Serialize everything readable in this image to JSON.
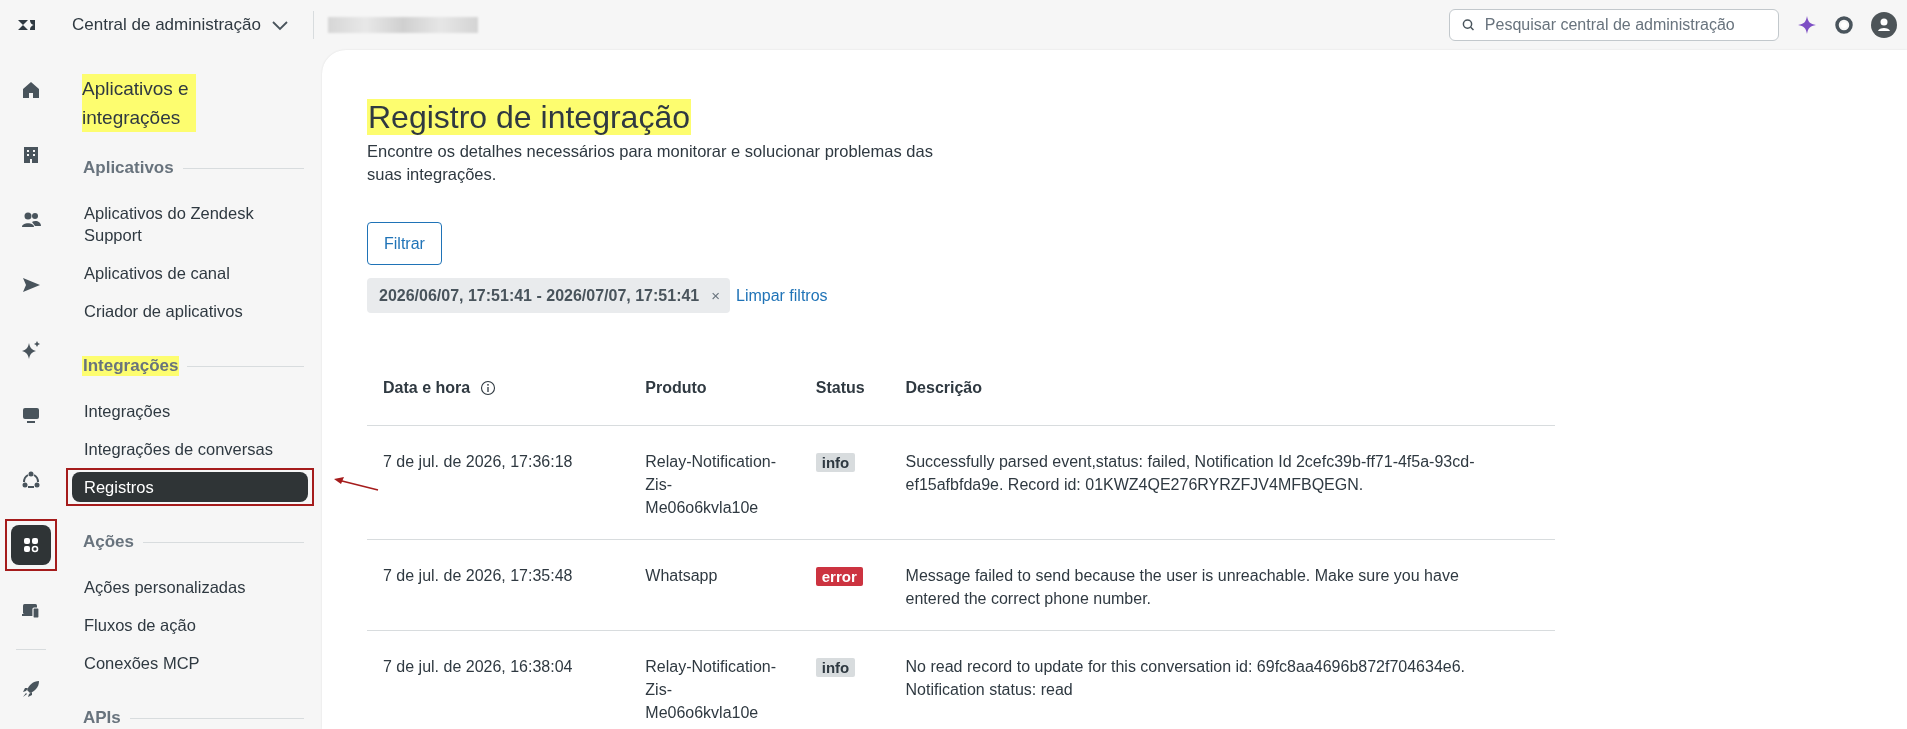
{
  "topbar": {
    "product": "Central de administração",
    "search": {
      "placeholder": "Pesquisar central de administração"
    }
  },
  "rail": {
    "items": [
      {
        "kind": "home",
        "selected": false,
        "annotated": false
      },
      {
        "kind": "building",
        "selected": false,
        "annotated": false
      },
      {
        "kind": "people",
        "selected": false,
        "annotated": false
      },
      {
        "kind": "send",
        "selected": false,
        "annotated": false
      },
      {
        "kind": "sparkle",
        "selected": false,
        "annotated": false
      },
      {
        "kind": "monitor",
        "selected": false,
        "annotated": false
      },
      {
        "kind": "cycle",
        "selected": false,
        "annotated": false
      },
      {
        "kind": "apps",
        "selected": true,
        "annotated": true
      },
      {
        "kind": "devices",
        "selected": false,
        "annotated": false
      }
    ],
    "footer": [
      {
        "kind": "rocket",
        "selected": false,
        "annotated": false
      }
    ]
  },
  "sidebar": {
    "heading": {
      "text": "Aplicativos e integrações",
      "highlighted": true
    },
    "sections": [
      {
        "title": "Aplicativos",
        "highlighted": false,
        "items": [
          {
            "label": "Aplicativos do Zendesk Support",
            "selected": false,
            "annotated": false
          },
          {
            "label": "Aplicativos de canal",
            "selected": false,
            "annotated": false
          },
          {
            "label": "Criador de aplicativos",
            "selected": false,
            "annotated": false
          }
        ]
      },
      {
        "title": "Integrações",
        "highlighted": true,
        "items": [
          {
            "label": "Integrações",
            "selected": false,
            "annotated": false
          },
          {
            "label": "Integrações de conversas",
            "selected": false,
            "annotated": false
          },
          {
            "label": "Registros",
            "selected": true,
            "annotated": true
          }
        ]
      },
      {
        "title": "Ações",
        "highlighted": false,
        "items": [
          {
            "label": "Ações personalizadas",
            "selected": false,
            "annotated": false
          },
          {
            "label": "Fluxos de ação",
            "selected": false,
            "annotated": false
          },
          {
            "label": "Conexões MCP",
            "selected": false,
            "annotated": false
          }
        ]
      },
      {
        "title": "APIs",
        "highlighted": false
      }
    ]
  },
  "page": {
    "title": "Registro de integração",
    "title_highlighted": true,
    "description": "Encontre os detalhes necessários para monitorar e solucionar problemas das suas integrações.",
    "filter_button": "Filtrar",
    "chip": {
      "label": "2026/06/07, 17:51:41 - 2026/07/07, 17:51:41",
      "remove": "×"
    },
    "clear_link": "Limpar filtros",
    "annotation_arrow": true
  },
  "table": {
    "columns": [
      {
        "label": "Data e hora",
        "info": true
      },
      {
        "label": "Produto",
        "info": false
      },
      {
        "label": "Status",
        "info": false
      },
      {
        "label": "Descrição",
        "info": false
      }
    ],
    "rows": [
      {
        "date": "7 de jul. de 2026, 17:36:18",
        "product": "Relay-Notification-Zis-Me06o6kvla10e",
        "status": {
          "text": "info",
          "kind": "info"
        },
        "description": "Successfully parsed event,status: failed, Notification Id 2cefc39b-ff71-4f5a-93cd-ef15afbfda9e. Record id: 01KWZ4QE276RYRZFJV4MFBQEGN."
      },
      {
        "date": "7 de jul. de 2026, 17:35:48",
        "product": "Whatsapp",
        "status": {
          "text": "error",
          "kind": "error"
        },
        "description": "Message failed to send because the user is unreachable. Make sure you have entered the correct phone number."
      },
      {
        "date": "7 de jul. de 2026, 16:38:04",
        "product": "Relay-Notification-Zis-Me06o6kvla10e",
        "status": {
          "text": "info",
          "kind": "info"
        },
        "description": "No read record to update for this conversation id: 69fc8aa4696b872f704634e6. Notification status: read"
      }
    ]
  }
}
